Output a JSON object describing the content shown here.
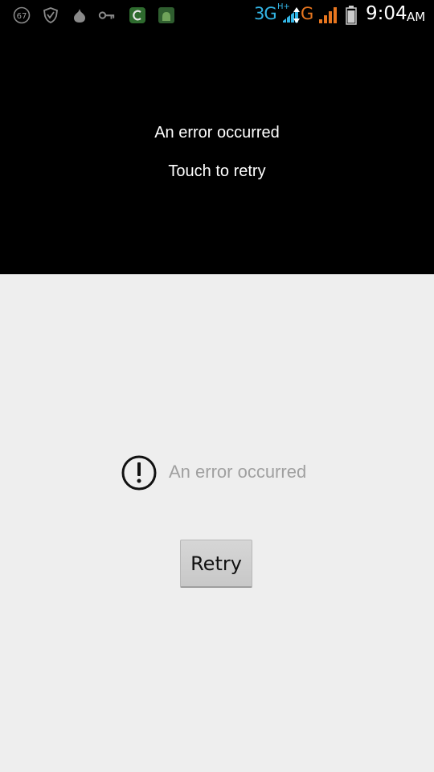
{
  "status_bar": {
    "notification_icons": [
      "battery-level-icon",
      "shield-icon",
      "droplet-icon",
      "key-icon",
      "cleaner-app-icon",
      "android-app-icon"
    ],
    "battery_notification_value": "67",
    "network_3g": "3G",
    "network_hplus": "H+",
    "network_g": "G",
    "time": "9:04",
    "ampm": "AM",
    "colors": {
      "network_blue": "#33b5e5",
      "network_orange": "#e8761f"
    }
  },
  "video": {
    "error_text": "An error occurred",
    "retry_text": "Touch to retry"
  },
  "content": {
    "error_text": "An error occurred",
    "retry_button_label": "Retry"
  }
}
